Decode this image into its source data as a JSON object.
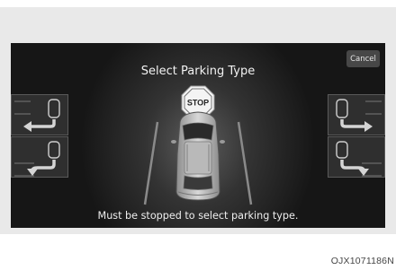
{
  "screen": {
    "title": "Select Parking Type",
    "cancel_label": "Cancel",
    "message": "Must be stopped to select parking type.",
    "stop_sign_text": "STOP"
  },
  "parking_options": [
    {
      "icon": "reverse-left-parking-icon"
    },
    {
      "icon": "forward-left-parking-icon"
    },
    {
      "icon": "reverse-right-parking-icon"
    },
    {
      "icon": "forward-right-parking-icon"
    }
  ],
  "image_code": "OJX1071186N",
  "colors": {
    "screen_bg": "#161616",
    "text": "#f2f2f2",
    "cancel_bg": "#474747"
  }
}
